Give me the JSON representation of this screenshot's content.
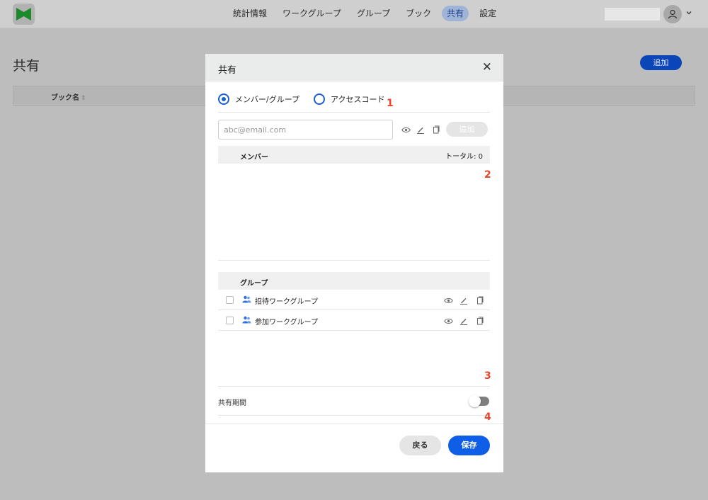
{
  "nav": {
    "items": [
      {
        "label": "統計情報"
      },
      {
        "label": "ワークグループ"
      },
      {
        "label": "グループ"
      },
      {
        "label": "ブック"
      },
      {
        "label": "共有",
        "active": true
      },
      {
        "label": "設定"
      }
    ]
  },
  "page": {
    "title": "共有",
    "add_label": "追加",
    "table": {
      "columns": [
        "ブック名"
      ]
    }
  },
  "modal": {
    "title": "共有",
    "radio": {
      "members_label": "メンバー/グループ",
      "access_code_label": "アクセスコード",
      "selected": "members"
    },
    "email": {
      "placeholder": "abc@email.com",
      "value": ""
    },
    "add_label": "追加",
    "members": {
      "header": "メンバー",
      "total": "トータル: 0"
    },
    "groups": {
      "header": "グループ",
      "items": [
        {
          "name": "招待ワークグループ",
          "checked": false
        },
        {
          "name": "参加ワークグループ",
          "checked": false
        }
      ]
    },
    "share_period": {
      "label": "共有期間",
      "enabled": false
    },
    "back_label": "戻る",
    "save_label": "保存"
  },
  "annotations": [
    "1",
    "2",
    "3",
    "4"
  ],
  "colors": {
    "accent": "#0f5ee8",
    "annotation": "#e8462c",
    "logo_green": "#1a8a2a"
  }
}
